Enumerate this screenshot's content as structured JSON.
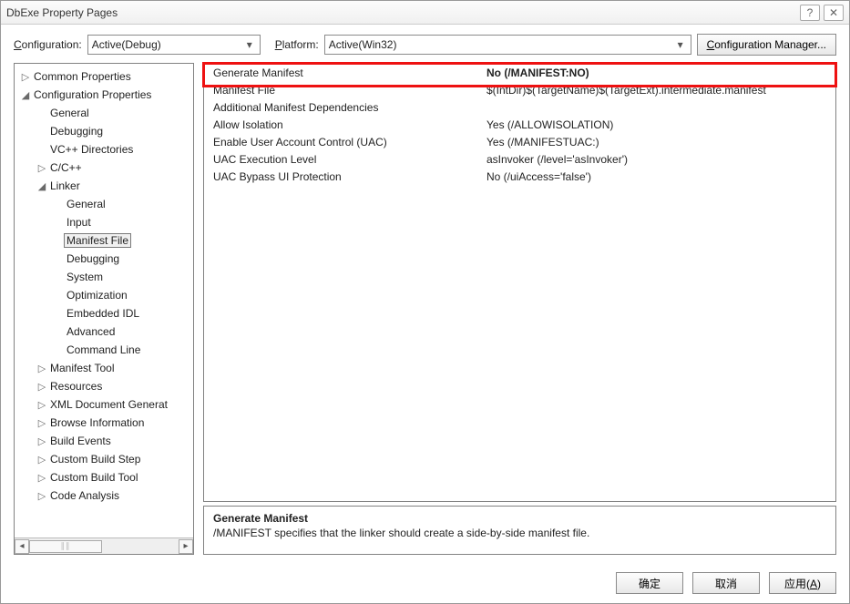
{
  "window": {
    "title": "DbExe Property Pages"
  },
  "toolbar": {
    "config_label": "Configuration:",
    "config_value": "Active(Debug)",
    "platform_label": "Platform:",
    "platform_value": "Active(Win32)",
    "config_manager_label": "Configuration Manager..."
  },
  "tree": {
    "items": [
      {
        "label": "Common Properties",
        "indent": 0,
        "tw": "▷"
      },
      {
        "label": "Configuration Properties",
        "indent": 0,
        "tw": "◢"
      },
      {
        "label": "General",
        "indent": 1,
        "tw": ""
      },
      {
        "label": "Debugging",
        "indent": 1,
        "tw": ""
      },
      {
        "label": "VC++ Directories",
        "indent": 1,
        "tw": ""
      },
      {
        "label": "C/C++",
        "indent": 1,
        "tw": "▷"
      },
      {
        "label": "Linker",
        "indent": 1,
        "tw": "◢"
      },
      {
        "label": "General",
        "indent": 2,
        "tw": ""
      },
      {
        "label": "Input",
        "indent": 2,
        "tw": ""
      },
      {
        "label": "Manifest File",
        "indent": 2,
        "tw": "",
        "selected": true
      },
      {
        "label": "Debugging",
        "indent": 2,
        "tw": ""
      },
      {
        "label": "System",
        "indent": 2,
        "tw": ""
      },
      {
        "label": "Optimization",
        "indent": 2,
        "tw": ""
      },
      {
        "label": "Embedded IDL",
        "indent": 2,
        "tw": ""
      },
      {
        "label": "Advanced",
        "indent": 2,
        "tw": ""
      },
      {
        "label": "Command Line",
        "indent": 2,
        "tw": ""
      },
      {
        "label": "Manifest Tool",
        "indent": 1,
        "tw": "▷"
      },
      {
        "label": "Resources",
        "indent": 1,
        "tw": "▷"
      },
      {
        "label": "XML Document Generat",
        "indent": 1,
        "tw": "▷"
      },
      {
        "label": "Browse Information",
        "indent": 1,
        "tw": "▷"
      },
      {
        "label": "Build Events",
        "indent": 1,
        "tw": "▷"
      },
      {
        "label": "Custom Build Step",
        "indent": 1,
        "tw": "▷"
      },
      {
        "label": "Custom Build Tool",
        "indent": 1,
        "tw": "▷"
      },
      {
        "label": "Code Analysis",
        "indent": 1,
        "tw": "▷"
      }
    ]
  },
  "grid": {
    "rows": [
      {
        "name": "Generate Manifest",
        "value": "No (/MANIFEST:NO)",
        "selected": true
      },
      {
        "name": "Manifest File",
        "value": "$(IntDir)$(TargetName)$(TargetExt).intermediate.manifest"
      },
      {
        "name": "Additional Manifest Dependencies",
        "value": ""
      },
      {
        "name": "Allow Isolation",
        "value": "Yes (/ALLOWISOLATION)"
      },
      {
        "name": "Enable User Account Control (UAC)",
        "value": "Yes (/MANIFESTUAC:)"
      },
      {
        "name": "UAC Execution Level",
        "value": "asInvoker (/level='asInvoker')"
      },
      {
        "name": "UAC Bypass UI Protection",
        "value": "No (/uiAccess='false')"
      }
    ]
  },
  "description": {
    "title": "Generate Manifest",
    "text": "/MANIFEST specifies that the linker should create a side-by-side manifest file."
  },
  "footer": {
    "ok": "确定",
    "cancel": "取消",
    "apply": "应用(A)"
  }
}
